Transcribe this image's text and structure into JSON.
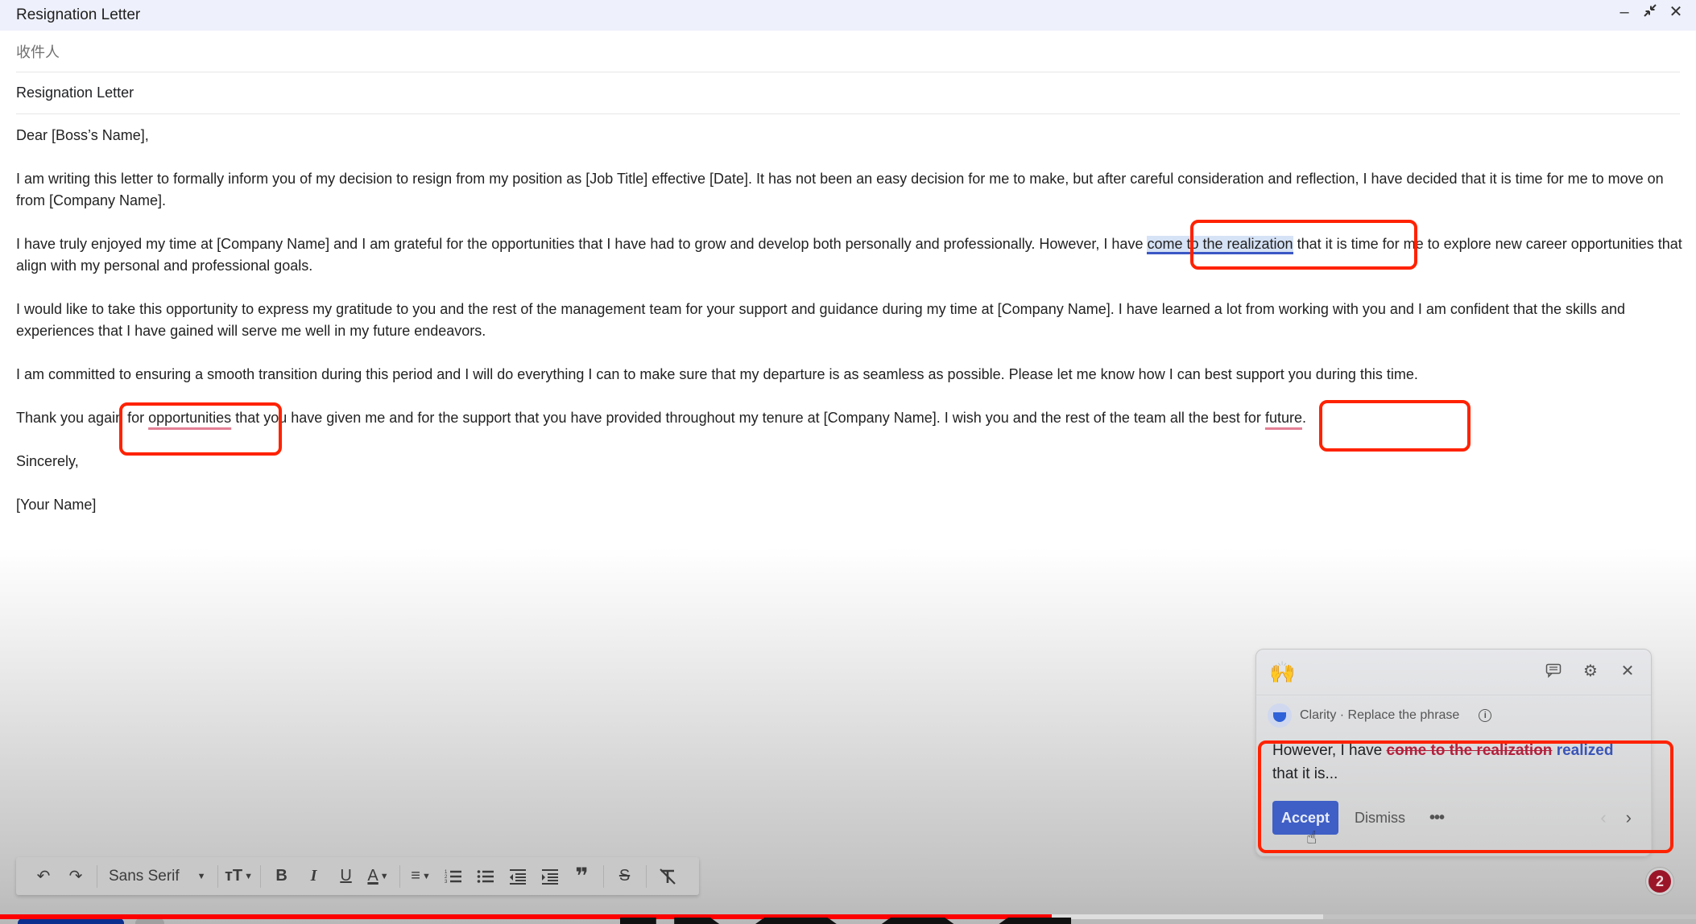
{
  "window": {
    "title": "Resignation Letter",
    "controls": [
      "minimize-icon",
      "exit-fullscreen-icon",
      "close-icon"
    ]
  },
  "compose": {
    "recipients_placeholder": "收件人",
    "subject": "Resignation Letter"
  },
  "letter": {
    "greeting": "Dear [Boss’s Name],",
    "p1": "I am writing this letter to formally inform you of my decision to resign from my position as [Job Title] effective [Date]. It has not been an easy decision for me to make, but after careful consideration and reflection, I have decided that it is time for me to move on from [Company Name].",
    "p2_before": "I have truly enjoyed my time at [Company Name] and I am grateful for the opportunities that I have had to grow and develop both personally and professionally. However, I have ",
    "p2_highlight": "come to the realization",
    "p2_after": " that it is time for me to explore new career opportunities that align with my personal and professional goals.",
    "p3": "I would like to take this opportunity to express my gratitude to you and the rest of the management team for your support and guidance during my time at [Company Name]. I have learned a lot from working with you and I am confident that the skills and experiences that I have gained will serve me well in my future endeavors.",
    "p4": "I am committed to ensuring a smooth transition during this period and I will do everything I can to make sure that my departure is as seamless as possible. Please let me know how I can best support you during this time.",
    "p5_part1": "Thank you again for ",
    "p5_err1": "opportunities",
    "p5_part2": " that you have given me and for the support that you have provided throughout my tenure at [Company Name]. I wish you and the rest of the team all the best for ",
    "p5_err2": "future",
    "p5_part3": ".",
    "closing": "Sincerely,",
    "signature": "[Your Name]"
  },
  "suggestion_card": {
    "emoji": "🙌",
    "header_icons": [
      "feedback-icon",
      "settings-icon",
      "close-icon"
    ],
    "category": "Clarity · Replace the phrase",
    "preview_before": "However, I have ",
    "preview_removed": "come to the realization",
    "preview_inserted": "realized",
    "preview_after": " that it is...",
    "accept_label": "Accept",
    "dismiss_label": "Dismiss",
    "more_label": "•••",
    "prev_label": "‹",
    "next_label": "›"
  },
  "suggestion_count": "2",
  "toolbar": {
    "undo": "↶",
    "redo": "↷",
    "font_family": "Sans Serif",
    "font_size_glyph": "тT",
    "bold": "B",
    "italic": "I",
    "underline": "U",
    "text_color": "A",
    "align": "≡",
    "numbered_list": "⒈",
    "bulleted_list": "•",
    "indent_less": "⇤",
    "indent_more": "⇥",
    "quote": "❞",
    "strikethrough": "S",
    "clear_formatting": "T̸"
  },
  "video": {
    "played_percent": 62,
    "buffered_percent": 78
  },
  "colors": {
    "annotation_red": "#ff2200",
    "highlight_blue": "#3a57c4",
    "accept_button": "#3f5fc6",
    "removed_text": "#b3203c",
    "inserted_text": "#3a55b8",
    "badge": "#9b1528",
    "progress_red": "#ff0000"
  }
}
